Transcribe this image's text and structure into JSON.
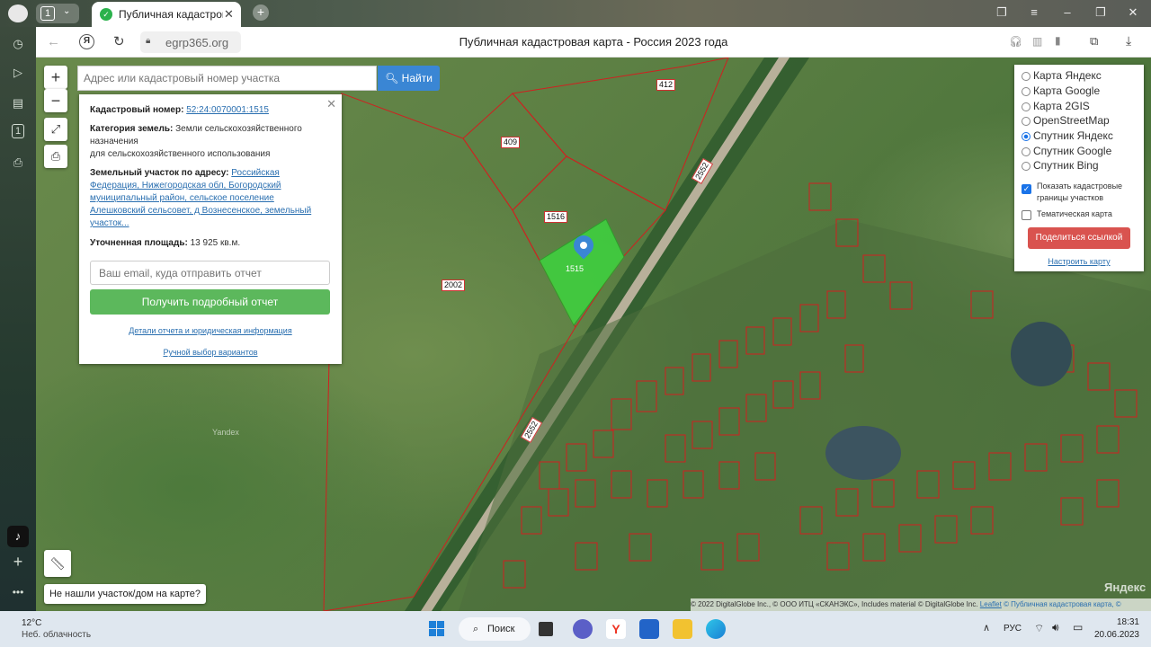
{
  "browser": {
    "tab_count": "1",
    "tab_title": "Публичная кадастровая карта",
    "url": "egrp365.org",
    "page_title": "Публичная кадастровая карта - Россия 2023 года"
  },
  "search": {
    "placeholder": "Адрес или кадастровый номер участка",
    "button_label": "Найти"
  },
  "map_controls": {
    "zoom_in": "+",
    "zoom_out": "−"
  },
  "info_panel": {
    "cadastral_label": "Кадастровый номер:",
    "cadastral_value": "52:24:0070001:1515",
    "category_label": "Категория земель:",
    "category_value_1": "Земли сельскохозяйственного",
    "category_value_2": "назначения",
    "category_value_3": "для сельскохозяйственного использования",
    "address_label": "Земельный участок по адресу:",
    "address_line_1": "Российская",
    "address_line_2": "Федерация, Нижегородская обл, Богородский",
    "address_line_3": "муниципальный район, сельское поселение",
    "address_line_4": "Алешковский сельсовет, д Вознесенское, земельный",
    "address_line_5": "участок...",
    "area_label": "Уточненная площадь:",
    "area_value": "13 925 кв.м.",
    "email_placeholder": "Ваш email, куда отправить отчет",
    "report_button": "Получить подробный отчет",
    "details_link": "Детали отчета и юридическая информация",
    "manual_link": "Ручной выбор вариантов"
  },
  "layers": {
    "options": [
      {
        "label": "Карта Яндекс",
        "selected": false
      },
      {
        "label": "Карта Google",
        "selected": false
      },
      {
        "label": "Карта 2GIS",
        "selected": false
      },
      {
        "label": "OpenStreetMap",
        "selected": false
      },
      {
        "label": "Спутник Яндекс",
        "selected": true
      },
      {
        "label": "Спутник Google",
        "selected": false
      },
      {
        "label": "Спутник Bing",
        "selected": false
      }
    ],
    "show_borders_1": "Показать кадастровые",
    "show_borders_2": "границы участков",
    "thematic": "Тематическая карта",
    "share_button": "Поделиться ссылкой",
    "configure_link": "Настроить карту"
  },
  "map": {
    "plot_labels": [
      "412",
      "409",
      "1516",
      "1515",
      "2002",
      "2552",
      "2552"
    ],
    "selected_plot": "1515",
    "not_found_button": "Не нашли участок/дом на карте?",
    "watermark": "Yandex",
    "brand": "Яндекс",
    "attribution": "© 2022 DigitalGlobe Inc., © ООО ИТЦ «СКАНЭКС», Includes material © DigitalGlobe Inc.",
    "leaflet_link": "Leaflet",
    "site_link": "© Публичная кадастровая карта, ©"
  },
  "taskbar": {
    "temperature": "12°C",
    "weather": "Неб. облачность",
    "search_label": "Поиск",
    "language": "РУС",
    "time": "18:31",
    "date": "20.06.2023"
  },
  "colors": {
    "accent_blue": "#3a86d4",
    "report_green": "#5cb85c",
    "share_red": "#d9534f",
    "selected_plot": "#3fcf3f",
    "cadastral_border": "#d02020"
  }
}
